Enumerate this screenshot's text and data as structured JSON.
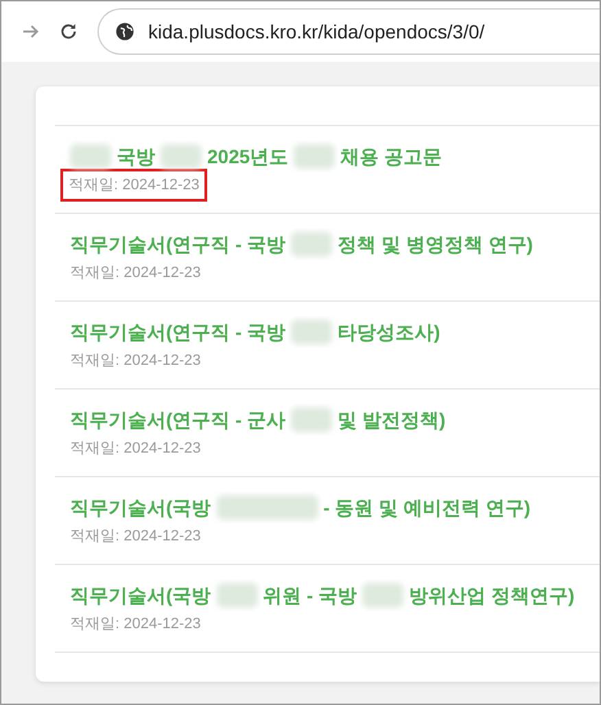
{
  "browser": {
    "url": "kida.plusdocs.kro.kr/kida/opendocs/3/0/"
  },
  "documents": [
    {
      "title": [
        {
          "kind": "blur"
        },
        {
          "kind": "text",
          "text": "국방"
        },
        {
          "kind": "blur"
        },
        {
          "kind": "text",
          "text": "2025년도"
        },
        {
          "kind": "blur"
        },
        {
          "kind": "text",
          "text": "채용 공고문"
        }
      ],
      "date": "적재일: 2024-12-23",
      "highlighted": true
    },
    {
      "title": [
        {
          "kind": "text",
          "text": "직무기술서(연구직 - 국방"
        },
        {
          "kind": "blur"
        },
        {
          "kind": "text",
          "text": "정책 및 병영정책 연구)"
        }
      ],
      "date": "적재일: 2024-12-23",
      "highlighted": false
    },
    {
      "title": [
        {
          "kind": "text",
          "text": "직무기술서(연구직 - 국방"
        },
        {
          "kind": "blur"
        },
        {
          "kind": "text",
          "text": "타당성조사)"
        }
      ],
      "date": "적재일: 2024-12-23",
      "highlighted": false
    },
    {
      "title": [
        {
          "kind": "text",
          "text": "직무기술서(연구직 - 군사"
        },
        {
          "kind": "blur"
        },
        {
          "kind": "text",
          "text": "및 발전정책)"
        }
      ],
      "date": "적재일: 2024-12-23",
      "highlighted": false
    },
    {
      "title": [
        {
          "kind": "text",
          "text": "직무기술서(국방"
        },
        {
          "kind": "longblur"
        },
        {
          "kind": "text",
          "text": "- 동원 및 예비전력 연구)"
        }
      ],
      "date": "적재일: 2024-12-23",
      "highlighted": false
    },
    {
      "title": [
        {
          "kind": "text",
          "text": "직무기술서(국방"
        },
        {
          "kind": "blur"
        },
        {
          "kind": "text",
          "text": "위원 - 국방"
        },
        {
          "kind": "blur"
        },
        {
          "kind": "text",
          "text": "방위산업 정책연구)"
        }
      ],
      "date": "적재일: 2024-12-23",
      "highlighted": false
    }
  ]
}
